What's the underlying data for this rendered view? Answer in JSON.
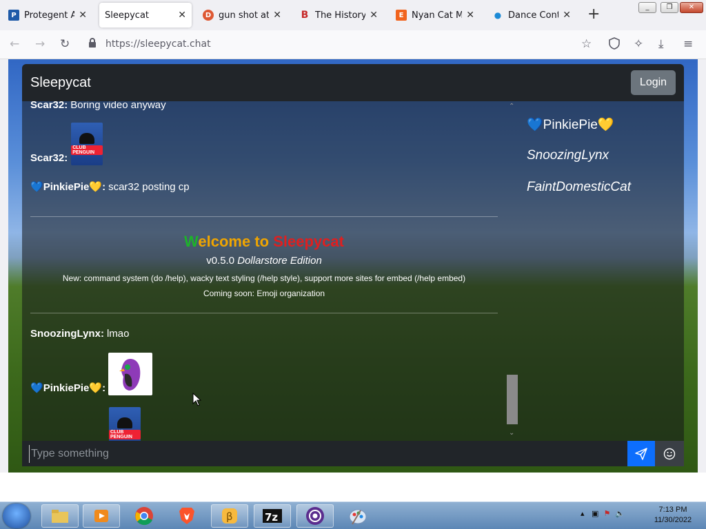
{
  "browser": {
    "tabs": [
      {
        "title": "Protegent Antivi",
        "favicon": "shield-logo-icon",
        "color": "#1e5aa8"
      },
      {
        "title": "Sleepycat",
        "favicon": "none",
        "color": "#ffffff",
        "active": true
      },
      {
        "title": "gun shot at Duc",
        "favicon": "duckduckgo-icon",
        "color": "#de5833"
      },
      {
        "title": "The History Of",
        "favicon": "b-icon",
        "color": "#c62828"
      },
      {
        "title": "Nyan Cat Mug",
        "favicon": "etsy-icon",
        "color": "#f1641e"
      },
      {
        "title": "Dance Contest |",
        "favicon": "dot-icon",
        "color": "#1c8ad6"
      }
    ],
    "url": "https://sleepycat.chat"
  },
  "app": {
    "brand": "Sleepycat",
    "login_label": "Login",
    "input_placeholder": "Type something"
  },
  "messages": [
    {
      "user": "Scar32:",
      "text": "Boring video anyway"
    },
    {
      "user": "Scar32:",
      "image": "club-penguin-logo",
      "image_text": "CLUB PENGUIN"
    },
    {
      "user": "PinkiePie",
      "hearts": [
        "💙",
        "💛"
      ],
      "text": "scar32 posting cp"
    },
    {
      "user": "SnoozingLynx:",
      "text": "lmao"
    },
    {
      "user": "PinkiePie",
      "hearts": [
        "💙",
        "💛"
      ],
      "image": "purple-penguin-sticker"
    },
    {
      "image": "club-penguin-logo",
      "image_text": "CLUB PENGUIN"
    }
  ],
  "welcome": {
    "title_parts": [
      "W",
      "elcome",
      " to ",
      "Sleepycat"
    ],
    "title_colors": [
      "#1db32a",
      "#f0a500",
      "#f0a500",
      "#e01f1f"
    ],
    "version": "v0.5.0",
    "edition": "Dollarstore Edition",
    "news": "New: command system (do /help), wacky text styling (/help style), support more sites for embed (/help embed)",
    "coming": "Coming soon: Emoji organization"
  },
  "online_users": [
    {
      "name": "PinkiePie",
      "hearts": [
        "💙",
        "💛"
      ],
      "italic": false
    },
    {
      "name": "SnoozingLynx",
      "italic": true
    },
    {
      "name": "FaintDomesticCat",
      "italic": true
    }
  ],
  "taskbar": {
    "time": "7:13 PM",
    "date": "11/30/2022"
  }
}
